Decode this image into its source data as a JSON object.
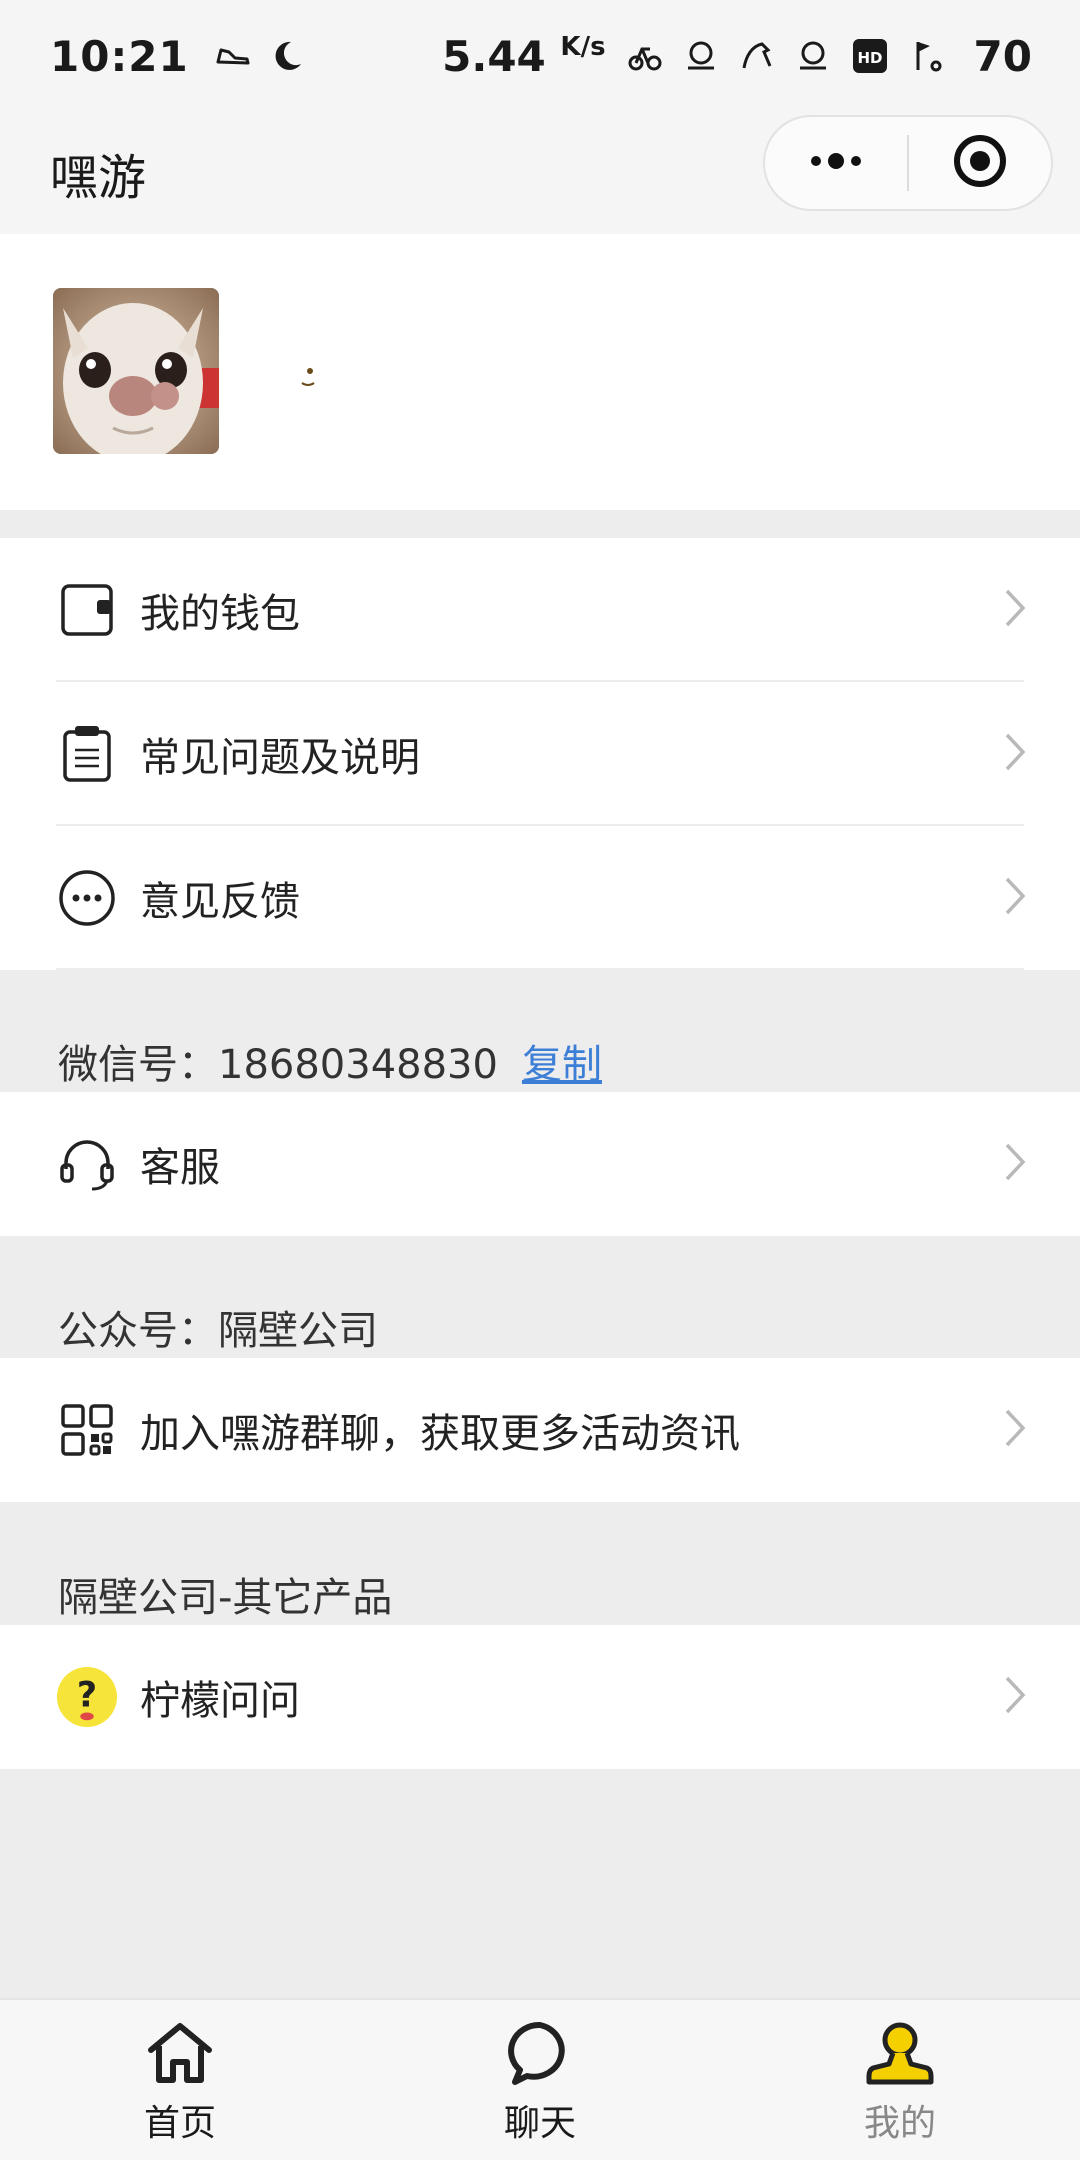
{
  "status_bar": {
    "time": "10:21",
    "network_speed": "5.44",
    "network_unit": "K/s",
    "battery": "70"
  },
  "nav": {
    "title": "嘿游"
  },
  "profile": {
    "avatar_alt": "dog-avatar"
  },
  "menu_primary": [
    {
      "label": "我的钱包",
      "icon": "wallet-icon"
    },
    {
      "label": "常见问题及说明",
      "icon": "clipboard-icon"
    },
    {
      "label": "意见反馈",
      "icon": "feedback-icon"
    }
  ],
  "wechat_section": {
    "label": "微信号：18680348830",
    "copy_label": "复制"
  },
  "service_item": {
    "label": "客服",
    "icon": "headset-icon"
  },
  "official_section": {
    "label": "公众号：隔壁公司"
  },
  "group_item": {
    "label": "加入嘿游群聊，获取更多活动资讯",
    "icon": "qrcode-icon"
  },
  "products_section": {
    "label": "隔壁公司-其它产品"
  },
  "product_item": {
    "label": "柠檬问问",
    "icon": "lemon-question-icon",
    "icon_color": "#f7e43a"
  },
  "tab_bar": [
    {
      "label": "首页",
      "icon": "home-icon",
      "active": false
    },
    {
      "label": "聊天",
      "icon": "chat-icon",
      "active": false
    },
    {
      "label": "我的",
      "icon": "user-icon",
      "active": true
    }
  ],
  "colors": {
    "accent_link": "#3d7fd6",
    "active_tab_icon": "#f5d000",
    "page_background": "#ededed"
  }
}
